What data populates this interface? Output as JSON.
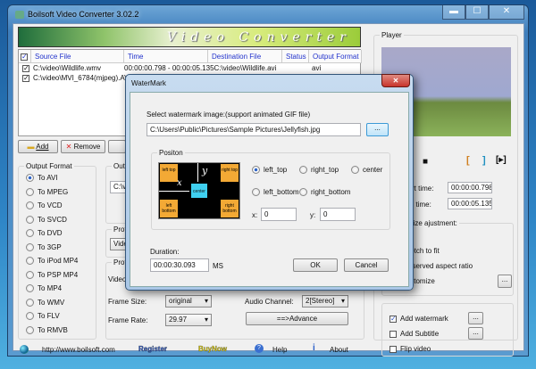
{
  "window": {
    "title": "Boilsoft Video Converter 3.02.2",
    "banner": "Video Converter",
    "controls": [
      "▬",
      "☐",
      "✕"
    ]
  },
  "file_list": {
    "columns": [
      "Source File",
      "Time",
      "Destination File",
      "Status",
      "Output Format"
    ],
    "rows": [
      {
        "checked": true,
        "source": "C:\\video\\Wildlife.wmv",
        "time": "00:00:00.798 - 00:00:05.135",
        "dest": "C:\\video\\Wildlife.avi",
        "status": "",
        "format": "avi"
      },
      {
        "checked": true,
        "source": "C:\\video\\MVI_6784(mjpeg).AVI",
        "time": "",
        "dest": "",
        "status": "",
        "format": ""
      }
    ]
  },
  "toolbar": {
    "add": "Add",
    "remove": "Remove"
  },
  "output_format": {
    "label": "Output Format",
    "selected": "To AVI",
    "options": [
      "To AVI",
      "To MPEG",
      "To VCD",
      "To SVCD",
      "To DVD",
      "To 3GP",
      "To iPod MP4",
      "To PSP MP4",
      "To MP4",
      "To WMV",
      "To FLV",
      "To RMVB"
    ]
  },
  "middle": {
    "output_label": "Output",
    "output_value": "C:\\video",
    "profile_label": "Profile",
    "profile_value": "Video",
    "profile2_label": "Profile",
    "video_label": "Video",
    "frame_size_label": "Frame Size:",
    "frame_size": "original",
    "frame_rate_label": "Frame Rate:",
    "frame_rate": "29.97",
    "audio_channel_label": "Audio Channel:",
    "audio_channel": "2[Stereo]",
    "advance": "==>Advance"
  },
  "footer": {
    "url": "http://www.boilsoft.com",
    "register": "Register",
    "buynow": "BuyNow",
    "help": "Help",
    "about": "About"
  },
  "player": {
    "label": "Player",
    "start_label": "Start time:",
    "start": "00:00:00.798",
    "end_label": "End time:",
    "end": "00:00:05.135",
    "size_label": "Video size ajustment:",
    "stretch": "Stretch to fit",
    "preserve": "Preserved aspect ratio",
    "customize": "Customize",
    "browse": "...",
    "watermark": "Add watermark",
    "watermark_checked": true,
    "subtitle": "Add Subtitle",
    "subtitle_checked": false,
    "flip": "Flip video",
    "flip_checked": false
  },
  "dialog": {
    "title": "WaterMark",
    "select_label": "Select watermark image:(support animated GIF file)",
    "path": "C:\\Users\\Public\\Pictures\\Sample Pictures\\Jellyfish.jpg",
    "browse": "...",
    "position_label": "Positon",
    "diagram": {
      "lt": "left top",
      "rt": "right top",
      "lb": "left bottom",
      "rb": "right bottom",
      "c": "center",
      "x": "x",
      "y": "y"
    },
    "positions": [
      "left_top",
      "right_top",
      "center",
      "left_bottom",
      "right_bottom"
    ],
    "selected": "left_top",
    "x_label": "x:",
    "x": "0",
    "y_label": "y:",
    "y": "0",
    "duration_label": "Duration:",
    "duration": "00:00:30.093",
    "ms": "MS",
    "ok": "OK",
    "cancel": "Cancel"
  },
  "colors": {
    "accent": "#2233cc",
    "register": "#3a5fc8",
    "buynow": "#e8d800",
    "close": "#c8342c"
  }
}
